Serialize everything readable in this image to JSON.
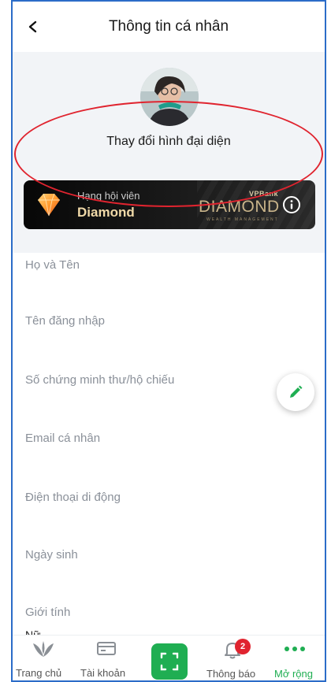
{
  "header": {
    "title": "Thông tin cá nhân"
  },
  "profile": {
    "change_avatar_label": "Thay đổi hình đại diện"
  },
  "member_card": {
    "tier_label": "Hạng hội viên",
    "tier_value": "Diamond",
    "brand_small": "VPBank",
    "brand_big": "DIAMOND",
    "brand_sub": "WEALTH MANAGEMENT"
  },
  "fields": [
    {
      "label": "Họ và Tên",
      "value": ""
    },
    {
      "label": "Tên đăng nhập",
      "value": ""
    },
    {
      "label": "Số chứng minh thư/hộ chiếu",
      "value": ""
    },
    {
      "label": "Email cá nhân",
      "value": ""
    },
    {
      "label": "Điện thoại di động",
      "value": ""
    },
    {
      "label": "Ngày sinh",
      "value": ""
    },
    {
      "label": "Giới tính",
      "value": "Nữ"
    }
  ],
  "bottom_nav": {
    "home": "Trang chủ",
    "account": "Tài khoản",
    "notifications": "Thông báo",
    "notification_count": "2",
    "more": "Mở rộng"
  },
  "colors": {
    "accent": "#1fae52",
    "badge": "#e0242f",
    "card_gold": "#f0d9a8",
    "annotation": "#e0242f"
  },
  "icons": [
    "back-arrow-icon",
    "diamond-icon",
    "info-icon",
    "edit-pencil-icon",
    "home-leaf-icon",
    "account-card-icon",
    "scan-icon",
    "bell-icon",
    "more-dots-icon"
  ]
}
